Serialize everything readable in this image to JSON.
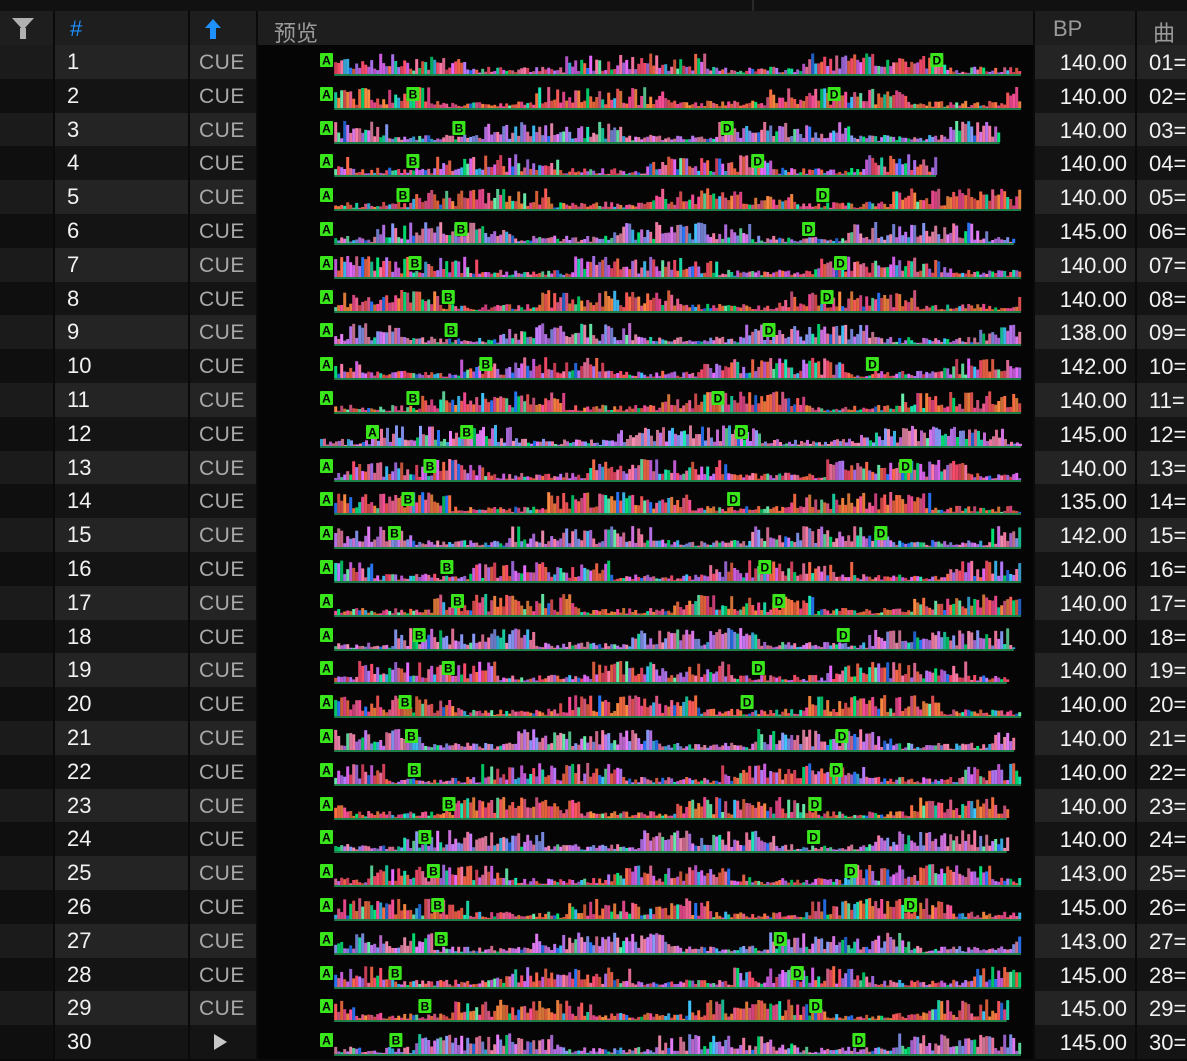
{
  "header": {
    "filter_icon": "filter-icon",
    "num_label": "#",
    "sort_icon": "arrow-up-icon",
    "preview_label": "预览",
    "bpm_label": "BP",
    "key_label": "曲"
  },
  "colors": {
    "accent_blue": "#1e90ff",
    "cue_marker": "#39e61c",
    "row_even": "#242424",
    "row_odd": "#141414"
  },
  "rows": [
    {
      "num": "1",
      "cue": "CUE",
      "bpm": "140.00",
      "key": "01=",
      "markers": [
        {
          "l": "A",
          "p": 0.0
        },
        {
          "l": "D",
          "p": 0.862
        }
      ],
      "wave_start": 0.02,
      "wave_end": 0.99
    },
    {
      "num": "2",
      "cue": "CUE",
      "bpm": "140.00",
      "key": "02=",
      "markers": [
        {
          "l": "A",
          "p": 0.0
        },
        {
          "l": "B",
          "p": 0.122
        },
        {
          "l": "D",
          "p": 0.717
        }
      ],
      "wave_start": 0.02,
      "wave_end": 0.99
    },
    {
      "num": "3",
      "cue": "CUE",
      "bpm": "140.00",
      "key": "03=",
      "markers": [
        {
          "l": "A",
          "p": 0.0
        },
        {
          "l": "B",
          "p": 0.187
        },
        {
          "l": "D",
          "p": 0.566
        }
      ],
      "wave_start": 0.02,
      "wave_end": 0.96
    },
    {
      "num": "4",
      "cue": "CUE",
      "bpm": "140.00",
      "key": "04=",
      "markers": [
        {
          "l": "A",
          "p": 0.0
        },
        {
          "l": "B",
          "p": 0.122
        },
        {
          "l": "D",
          "p": 0.609
        }
      ],
      "wave_start": 0.02,
      "wave_end": 0.87
    },
    {
      "num": "5",
      "cue": "CUE",
      "bpm": "140.00",
      "key": "05=",
      "markers": [
        {
          "l": "A",
          "p": 0.0
        },
        {
          "l": "B",
          "p": 0.108
        },
        {
          "l": "D",
          "p": 0.701
        }
      ],
      "wave_start": 0.02,
      "wave_end": 0.99
    },
    {
      "num": "6",
      "cue": "CUE",
      "bpm": "145.00",
      "key": "06=",
      "markers": [
        {
          "l": "A",
          "p": 0.0
        },
        {
          "l": "B",
          "p": 0.19
        },
        {
          "l": "D",
          "p": 0.681
        }
      ],
      "wave_start": 0.02,
      "wave_end": 0.98
    },
    {
      "num": "7",
      "cue": "CUE",
      "bpm": "140.00",
      "key": "07=",
      "markers": [
        {
          "l": "A",
          "p": 0.0
        },
        {
          "l": "B",
          "p": 0.125
        },
        {
          "l": "D",
          "p": 0.726
        }
      ],
      "wave_start": 0.02,
      "wave_end": 0.99
    },
    {
      "num": "8",
      "cue": "CUE",
      "bpm": "140.00",
      "key": "08=",
      "markers": [
        {
          "l": "A",
          "p": 0.0
        },
        {
          "l": "B",
          "p": 0.172
        },
        {
          "l": "D",
          "p": 0.707
        }
      ],
      "wave_start": 0.02,
      "wave_end": 0.99
    },
    {
      "num": "9",
      "cue": "CUE",
      "bpm": "138.00",
      "key": "09=",
      "markers": [
        {
          "l": "A",
          "p": 0.0
        },
        {
          "l": "B",
          "p": 0.176
        },
        {
          "l": "D",
          "p": 0.625
        }
      ],
      "wave_start": 0.02,
      "wave_end": 0.99
    },
    {
      "num": "10",
      "cue": "CUE",
      "bpm": "142.00",
      "key": "10=",
      "markers": [
        {
          "l": "A",
          "p": 0.0
        },
        {
          "l": "B",
          "p": 0.225
        },
        {
          "l": "D",
          "p": 0.771
        }
      ],
      "wave_start": 0.02,
      "wave_end": 0.99
    },
    {
      "num": "11",
      "cue": "CUE",
      "bpm": "140.00",
      "key": "11=",
      "markers": [
        {
          "l": "A",
          "p": 0.0
        },
        {
          "l": "B",
          "p": 0.122
        },
        {
          "l": "D",
          "p": 0.553
        }
      ],
      "wave_start": 0.02,
      "wave_end": 0.99
    },
    {
      "num": "12",
      "cue": "CUE",
      "bpm": "145.00",
      "key": "12=",
      "markers": [
        {
          "l": "A",
          "p": 0.065
        },
        {
          "l": "B",
          "p": 0.198
        },
        {
          "l": "D",
          "p": 0.586
        }
      ],
      "wave_start": 0.0,
      "wave_end": 0.99
    },
    {
      "num": "13",
      "cue": "CUE",
      "bpm": "140.00",
      "key": "13=",
      "markers": [
        {
          "l": "A",
          "p": 0.0
        },
        {
          "l": "B",
          "p": 0.146
        },
        {
          "l": "D",
          "p": 0.818
        }
      ],
      "wave_start": 0.02,
      "wave_end": 0.99
    },
    {
      "num": "14",
      "cue": "CUE",
      "bpm": "135.00",
      "key": "14=",
      "markers": [
        {
          "l": "A",
          "p": 0.0
        },
        {
          "l": "B",
          "p": 0.115
        },
        {
          "l": "D",
          "p": 0.575
        }
      ],
      "wave_start": 0.02,
      "wave_end": 0.99
    },
    {
      "num": "15",
      "cue": "CUE",
      "bpm": "142.00",
      "key": "15=",
      "markers": [
        {
          "l": "A",
          "p": 0.0
        },
        {
          "l": "B",
          "p": 0.096
        },
        {
          "l": "D",
          "p": 0.783
        }
      ],
      "wave_start": 0.02,
      "wave_end": 0.99
    },
    {
      "num": "16",
      "cue": "CUE",
      "bpm": "140.06",
      "key": "16=",
      "markers": [
        {
          "l": "A",
          "p": 0.0
        },
        {
          "l": "B",
          "p": 0.17
        },
        {
          "l": "D",
          "p": 0.619
        }
      ],
      "wave_start": 0.02,
      "wave_end": 0.99
    },
    {
      "num": "17",
      "cue": "CUE",
      "bpm": "140.00",
      "key": "17=",
      "markers": [
        {
          "l": "A",
          "p": 0.0
        },
        {
          "l": "B",
          "p": 0.185
        },
        {
          "l": "D",
          "p": 0.639
        }
      ],
      "wave_start": 0.02,
      "wave_end": 0.99
    },
    {
      "num": "18",
      "cue": "CUE",
      "bpm": "140.00",
      "key": "18=",
      "markers": [
        {
          "l": "A",
          "p": 0.0
        },
        {
          "l": "B",
          "p": 0.131
        },
        {
          "l": "D",
          "p": 0.73
        }
      ],
      "wave_start": 0.02,
      "wave_end": 0.98
    },
    {
      "num": "19",
      "cue": "CUE",
      "bpm": "140.00",
      "key": "19=",
      "markers": [
        {
          "l": "A",
          "p": 0.0
        },
        {
          "l": "B",
          "p": 0.172
        },
        {
          "l": "D",
          "p": 0.61
        }
      ],
      "wave_start": 0.02,
      "wave_end": 0.97
    },
    {
      "num": "20",
      "cue": "CUE",
      "bpm": "140.00",
      "key": "20=",
      "markers": [
        {
          "l": "A",
          "p": 0.0
        },
        {
          "l": "B",
          "p": 0.111
        },
        {
          "l": "D",
          "p": 0.594
        }
      ],
      "wave_start": 0.02,
      "wave_end": 0.99
    },
    {
      "num": "21",
      "cue": "CUE",
      "bpm": "140.00",
      "key": "21=",
      "markers": [
        {
          "l": "A",
          "p": 0.0
        },
        {
          "l": "B",
          "p": 0.12
        },
        {
          "l": "D",
          "p": 0.728
        }
      ],
      "wave_start": 0.02,
      "wave_end": 0.98
    },
    {
      "num": "22",
      "cue": "CUE",
      "bpm": "140.00",
      "key": "22=",
      "markers": [
        {
          "l": "A",
          "p": 0.0
        },
        {
          "l": "B",
          "p": 0.124
        },
        {
          "l": "D",
          "p": 0.72
        }
      ],
      "wave_start": 0.02,
      "wave_end": 0.99
    },
    {
      "num": "23",
      "cue": "CUE",
      "bpm": "140.00",
      "key": "23=",
      "markers": [
        {
          "l": "A",
          "p": 0.0
        },
        {
          "l": "B",
          "p": 0.173
        },
        {
          "l": "D",
          "p": 0.69
        }
      ],
      "wave_start": 0.02,
      "wave_end": 0.97
    },
    {
      "num": "24",
      "cue": "CUE",
      "bpm": "140.00",
      "key": "24=",
      "markers": [
        {
          "l": "A",
          "p": 0.0
        },
        {
          "l": "B",
          "p": 0.139
        },
        {
          "l": "D",
          "p": 0.688
        }
      ],
      "wave_start": 0.02,
      "wave_end": 0.97
    },
    {
      "num": "25",
      "cue": "CUE",
      "bpm": "143.00",
      "key": "25=",
      "markers": [
        {
          "l": "A",
          "p": 0.0
        },
        {
          "l": "B",
          "p": 0.151
        },
        {
          "l": "D",
          "p": 0.741
        }
      ],
      "wave_start": 0.02,
      "wave_end": 0.99
    },
    {
      "num": "26",
      "cue": "CUE",
      "bpm": "145.00",
      "key": "26=",
      "markers": [
        {
          "l": "A",
          "p": 0.0
        },
        {
          "l": "B",
          "p": 0.157
        },
        {
          "l": "D",
          "p": 0.825
        }
      ],
      "wave_start": 0.02,
      "wave_end": 0.99
    },
    {
      "num": "27",
      "cue": "CUE",
      "bpm": "143.00",
      "key": "27=",
      "markers": [
        {
          "l": "A",
          "p": 0.0
        },
        {
          "l": "B",
          "p": 0.162
        },
        {
          "l": "D",
          "p": 0.641
        }
      ],
      "wave_start": 0.02,
      "wave_end": 0.99
    },
    {
      "num": "28",
      "cue": "CUE",
      "bpm": "145.00",
      "key": "28=",
      "markers": [
        {
          "l": "A",
          "p": 0.0
        },
        {
          "l": "B",
          "p": 0.097
        },
        {
          "l": "D",
          "p": 0.665
        }
      ],
      "wave_start": 0.02,
      "wave_end": 0.99
    },
    {
      "num": "29",
      "cue": "CUE",
      "bpm": "145.00",
      "key": "29=",
      "markers": [
        {
          "l": "A",
          "p": 0.0
        },
        {
          "l": "B",
          "p": 0.139
        },
        {
          "l": "D",
          "p": 0.691
        }
      ],
      "wave_start": 0.02,
      "wave_end": 0.97
    },
    {
      "num": "30",
      "cue": "",
      "bpm": "145.00",
      "key": "30=",
      "play_icon": "play-icon",
      "markers": [
        {
          "l": "A",
          "p": 0.0
        },
        {
          "l": "B",
          "p": 0.098
        },
        {
          "l": "D",
          "p": 0.752
        }
      ],
      "wave_start": 0.02,
      "wave_end": 0.99
    }
  ]
}
